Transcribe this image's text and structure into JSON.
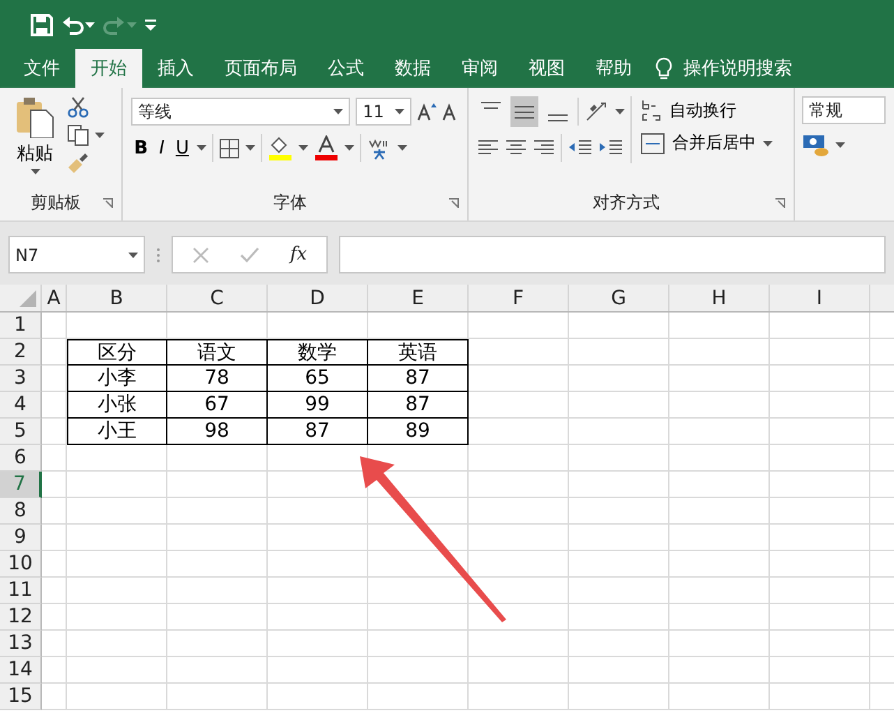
{
  "quick_access": [
    {
      "kind": "save",
      "disabled": false
    },
    {
      "kind": "undo",
      "disabled": false
    },
    {
      "kind": "redo",
      "disabled": true
    },
    {
      "kind": "customize",
      "disabled": false
    }
  ],
  "tabs": [
    {
      "label": "文件",
      "selected": false
    },
    {
      "label": "开始",
      "selected": true
    },
    {
      "label": "插入",
      "selected": false
    },
    {
      "label": "页面布局",
      "selected": false
    },
    {
      "label": "公式",
      "selected": false
    },
    {
      "label": "数据",
      "selected": false
    },
    {
      "label": "审阅",
      "selected": false
    },
    {
      "label": "视图",
      "selected": false
    },
    {
      "label": "帮助",
      "selected": false
    }
  ],
  "tell_me": "操作说明搜索",
  "ribbon": {
    "clipboard": {
      "paste": "粘贴",
      "label": "剪贴板"
    },
    "font": {
      "font_name": "等线",
      "font_size": "11",
      "label": "字体",
      "bold": "B",
      "italic": "I",
      "underline": "U"
    },
    "alignment": {
      "vertical_align": [
        {
          "selected": false
        },
        {
          "selected": true
        },
        {
          "selected": false
        }
      ],
      "wrap_text": "自动换行",
      "merge_center": "合并后居中",
      "label": "对齐方式"
    },
    "number": {
      "format": "常规"
    }
  },
  "formula_bar": {
    "name_box": "N7",
    "fx": "fx"
  },
  "sheet": {
    "columns": [
      "A",
      "B",
      "C",
      "D",
      "E",
      "F",
      "G",
      "H",
      "I"
    ],
    "rows": [
      {
        "header": "1",
        "selected": false
      },
      {
        "header": "2",
        "selected": false,
        "cells": [
          "区分",
          "语文",
          "数学",
          "英语"
        ]
      },
      {
        "header": "3",
        "selected": false,
        "cells": [
          "小李",
          "78",
          "65",
          "87"
        ]
      },
      {
        "header": "4",
        "selected": false,
        "cells": [
          "小张",
          "67",
          "99",
          "87"
        ]
      },
      {
        "header": "5",
        "selected": false,
        "cells": [
          "小王",
          "98",
          "87",
          "89"
        ]
      },
      {
        "header": "6",
        "selected": false
      },
      {
        "header": "7",
        "selected": true
      },
      {
        "header": "8",
        "selected": false
      },
      {
        "header": "9",
        "selected": false
      },
      {
        "header": "10",
        "selected": false
      },
      {
        "header": "11",
        "selected": false
      },
      {
        "header": "12",
        "selected": false
      },
      {
        "header": "13",
        "selected": false
      },
      {
        "header": "14",
        "selected": false
      },
      {
        "header": "15",
        "selected": false
      }
    ]
  }
}
